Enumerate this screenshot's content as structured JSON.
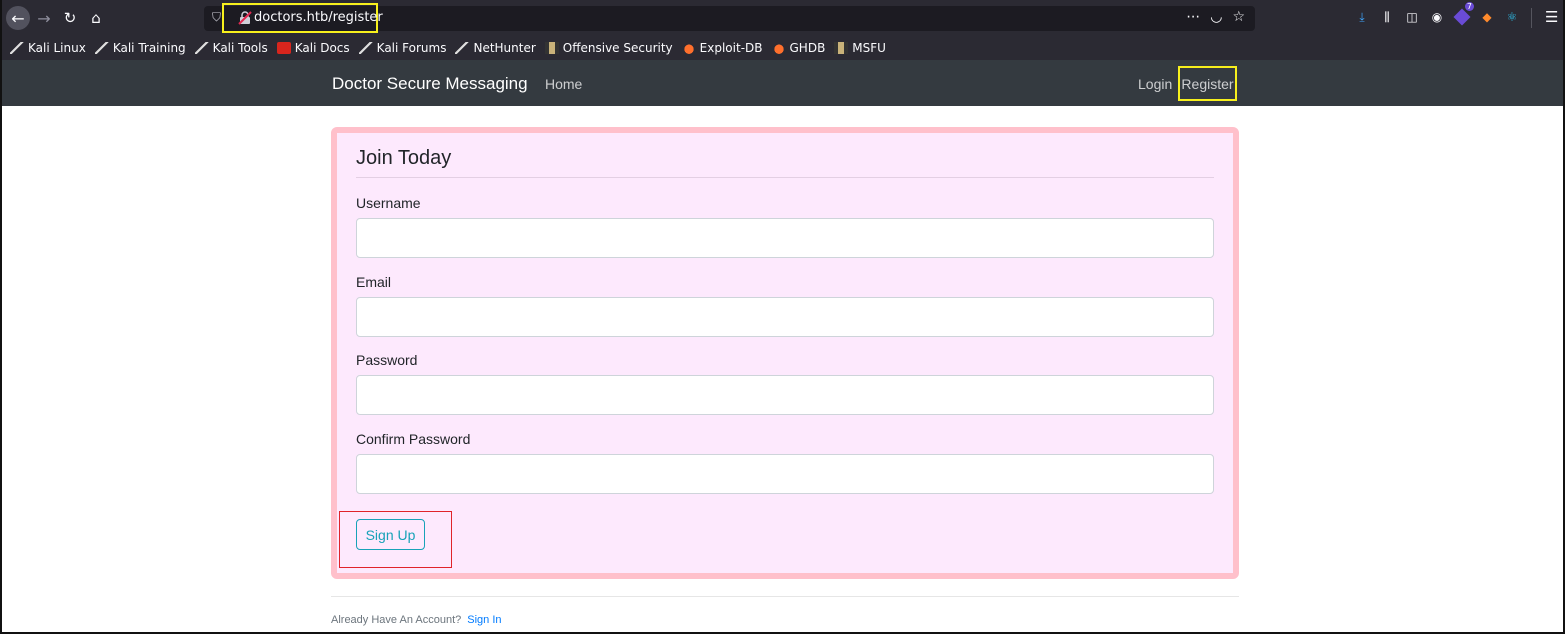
{
  "browser": {
    "url": "doctors.htb/register",
    "icons": {
      "back": "back-arrow-icon",
      "forward": "forward-arrow-icon",
      "reload": "reload-icon",
      "home": "home-icon",
      "tracking": "shield-icon",
      "insecure": "insecure-lock-icon",
      "page_actions": "more-icon",
      "pocket": "pocket-icon",
      "bookmark": "star-icon",
      "download": "download-icon",
      "library": "library-icon",
      "sidebar": "sidebar-icon",
      "account": "account-icon",
      "menu": "hamburger-menu-icon"
    },
    "extension_badge": "7"
  },
  "bookmarks": [
    {
      "label": "Kali Linux",
      "icon": "kali-dragon-icon"
    },
    {
      "label": "Kali Training",
      "icon": "kali-dragon-icon"
    },
    {
      "label": "Kali Tools",
      "icon": "kali-dragon-icon"
    },
    {
      "label": "Kali Docs",
      "icon": "kali-docs-icon"
    },
    {
      "label": "Kali Forums",
      "icon": "kali-dragon-icon"
    },
    {
      "label": "NetHunter",
      "icon": "kali-dragon-icon"
    },
    {
      "label": "Offensive Security",
      "icon": "offsec-icon"
    },
    {
      "label": "Exploit-DB",
      "icon": "exploit-db-icon"
    },
    {
      "label": "GHDB",
      "icon": "exploit-db-icon"
    },
    {
      "label": "MSFU",
      "icon": "offsec-icon"
    }
  ],
  "site_nav": {
    "brand": "Doctor Secure Messaging",
    "home": "Home",
    "login": "Login",
    "register": "Register"
  },
  "form": {
    "title": "Join Today",
    "fields": [
      {
        "label": "Username",
        "value": ""
      },
      {
        "label": "Email",
        "value": ""
      },
      {
        "label": "Password",
        "value": ""
      },
      {
        "label": "Confirm Password",
        "value": ""
      }
    ],
    "submit": "Sign Up"
  },
  "footer": {
    "text": "Already Have An Account?",
    "link": "Sign In"
  },
  "colors": {
    "highlight_yellow": "#f7f01d",
    "highlight_red": "#e0242a",
    "card_border": "#ffc0cb",
    "card_bg": "#fde9fd",
    "navbar": "#343a40",
    "button_info": "#17a2b8",
    "link": "#007bff"
  }
}
